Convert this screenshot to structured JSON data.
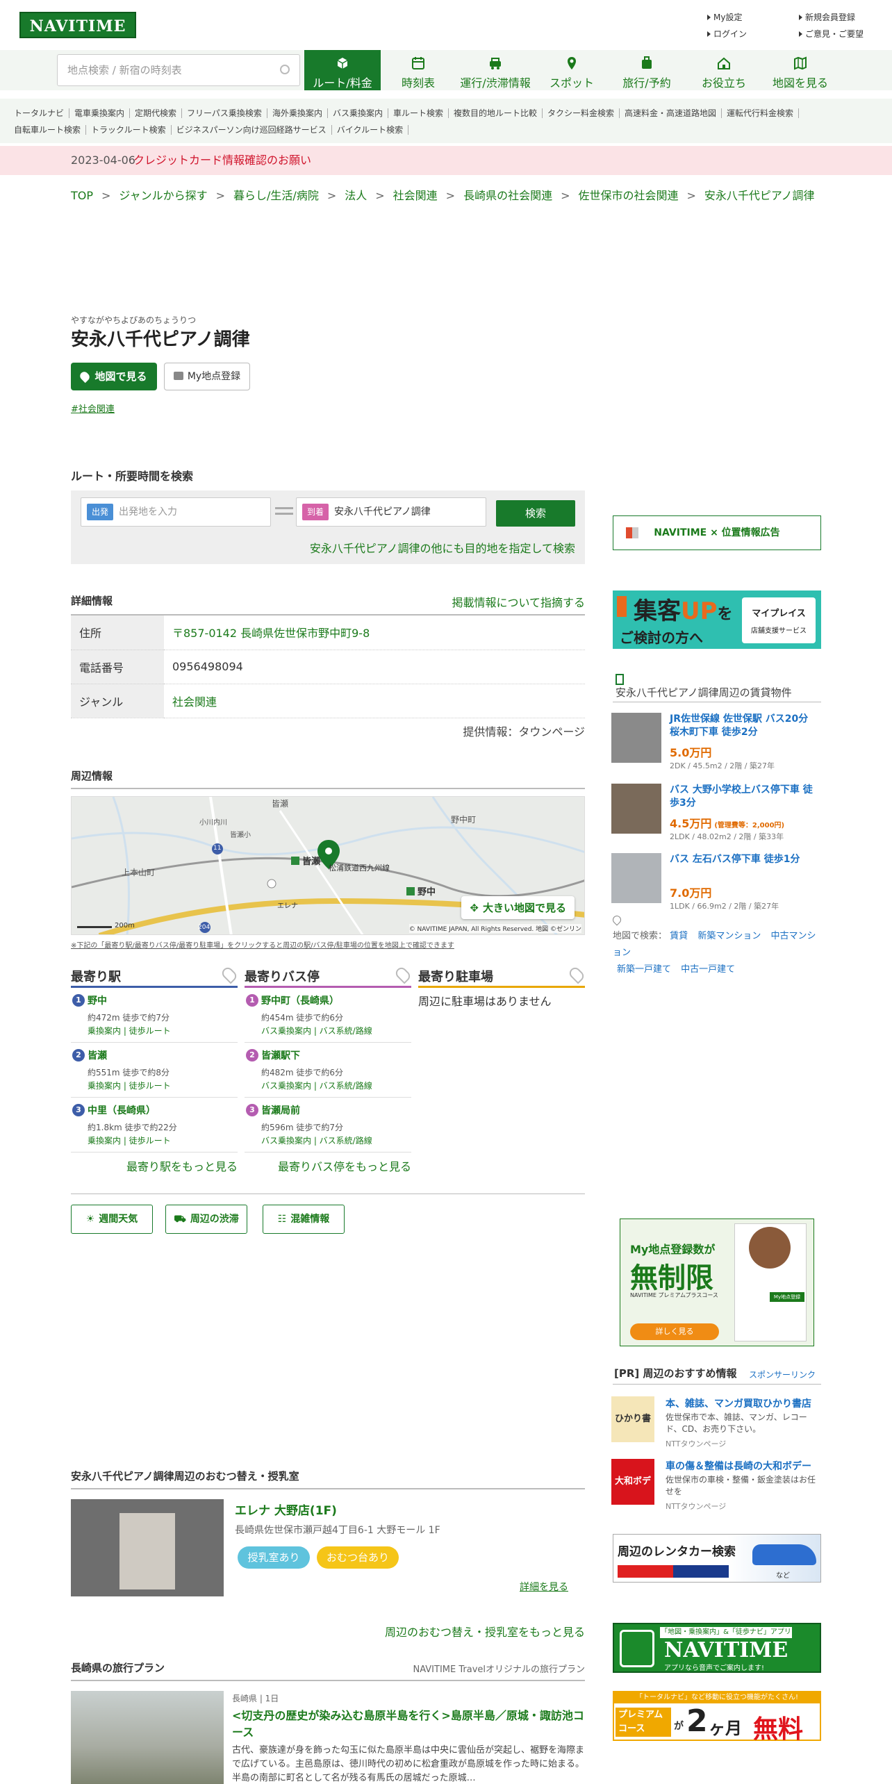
{
  "header": {
    "logo": "NAVITIME",
    "links": [
      "My設定",
      "新規会員登録",
      "ログイン",
      "ご意見・ご要望"
    ]
  },
  "search": {
    "placeholder": "地点検索 / 新宿の時刻表"
  },
  "nav": [
    "ルート/料金",
    "時刻表",
    "運行/渋滞情報",
    "スポット",
    "旅行/予約",
    "お役立ち",
    "地図を見る"
  ],
  "subnav": {
    "row1": [
      "トータルナビ",
      "電車乗換案内",
      "定期代検索",
      "フリーパス乗換検索",
      "海外乗換案内",
      "バス乗換案内",
      "車ルート検索",
      "複数目的地ルート比較",
      "タクシー料金検索",
      "高速料金・高速道路地図",
      "運転代行料金検索"
    ],
    "row2": [
      "自転車ルート検索",
      "トラックルート検索",
      "ビジネスパーソン向け巡回経路サービス",
      "バイクルート検索"
    ]
  },
  "notice": {
    "date": "2023-04-06",
    "text": "クレジットカード情報確認のお願い"
  },
  "breadcrumb": [
    "TOP",
    "ジャンルから探す",
    "暮らし/生活/病院",
    "法人",
    "社会関連",
    "長崎県の社会関連",
    "佐世保市の社会関連",
    "安永八千代ピアノ調律"
  ],
  "spot": {
    "kana": "やすながやちよぴあのちょうりつ",
    "name": "安永八千代ピアノ調律",
    "map_btn": "地図で見る",
    "my_btn": "My地点登録",
    "tag": "#社会関連"
  },
  "route": {
    "heading": "ルート・所要時間を検索",
    "from_badge": "出発",
    "from_placeholder": "出発地を入力",
    "to_badge": "到着",
    "to_value": "安永八千代ピアノ調律",
    "search": "検索",
    "multi": "安永八千代ピアノ調律の他にも目的地を指定して検索"
  },
  "detail": {
    "heading": "詳細情報",
    "report": "掲載情報について指摘する",
    "rows": [
      {
        "k": "住所",
        "v": "〒857-0142 長崎県佐世保市野中町9-8"
      },
      {
        "k": "電話番号",
        "v": "0956498094"
      },
      {
        "k": "ジャンル",
        "v": "社会関連"
      }
    ],
    "source": "提供情報：タウンページ"
  },
  "nearby": {
    "heading": "周辺情報",
    "map_labels": [
      "皆瀬",
      "野中町",
      "上本山町",
      "皆瀬",
      "松浦鉄道西九州線",
      "野中",
      "エレナ",
      "11",
      "204",
      "小川内川",
      "皆瀬小"
    ],
    "bigmap": "大きい地図で見る",
    "scale": "200m",
    "copyright": "© NAVITIME JAPAN, All Rights Reserved. 地図 ©ゼンリン",
    "note": "※下記の「最寄り駅/最寄りバス停/最寄り駐車場」をクリックすると周辺の駅/バス停/駐車場の位置を地図上で確認できます"
  },
  "stations": {
    "heading": "最寄り駅",
    "items": [
      {
        "n": "1",
        "name": "野中",
        "dist": "約472m 徒歩で約7分",
        "links": "乗換案内 | 徒歩ルート"
      },
      {
        "n": "2",
        "name": "皆瀬",
        "dist": "約551m 徒歩で約8分",
        "links": "乗換案内 | 徒歩ルート"
      },
      {
        "n": "3",
        "name": "中里（長崎県）",
        "dist": "約1.8km 徒歩で約22分",
        "links": "乗換案内 | 徒歩ルート"
      }
    ],
    "more": "最寄り駅をもっと見る"
  },
  "busstops": {
    "heading": "最寄りバス停",
    "items": [
      {
        "n": "1",
        "name": "野中町（長崎県）",
        "dist": "約454m 徒歩で約6分",
        "links": "バス乗換案内 | バス系統/路線"
      },
      {
        "n": "2",
        "name": "皆瀬駅下",
        "dist": "約482m 徒歩で約6分",
        "links": "バス乗換案内 | バス系統/路線"
      },
      {
        "n": "3",
        "name": "皆瀬局前",
        "dist": "約596m 徒歩で約7分",
        "links": "バス乗換案内 | バス系統/路線"
      }
    ],
    "more": "最寄りバス停をもっと見る"
  },
  "parking": {
    "heading": "最寄り駐車場",
    "empty": "周辺に駐車場はありません"
  },
  "chips": [
    "週間天気",
    "周辺の渋滞",
    "混雑情報"
  ],
  "nursing": {
    "heading": "安永八千代ピアノ調律周辺のおむつ替え・授乳室",
    "name": "エレナ 大野店(1F)",
    "addr": "長崎県佐世保市瀬戸越4丁目6-1 大野モール 1F",
    "tag1": "授乳室あり",
    "tag2": "おむつ台あり",
    "detail": "詳細を見る",
    "more": "周辺のおむつ替え・授乳室をもっと見る"
  },
  "travel": {
    "heading": "長崎県の旅行プラン",
    "sub": "NAVITIME Travelオリジナルの旅行プラン",
    "meta": "長崎県 | 1日",
    "title": "<切支丹の歴史が染み込む島原半島を行く>島原半島／原城・諏訪池コース",
    "desc": "古代、豪族達が身を飾った勾玉に似た島原半島は中央に雲仙岳が突起し、裾野を海際まで広げている。主邑島原は、徳川時代の初めに松倉重政が島原城を作った時に始まる。半島の南部に町名として名が残る有馬氏の居城だった原城…"
  },
  "right": {
    "ad_btn": "NAVITIME × 位置情報広告",
    "banner1": {
      "a": "集客",
      "b": "UP",
      "c": "を",
      "d": "ご検討の方へ",
      "e": "マイプレイス",
      "f": "店舗支援サービス"
    },
    "rent_heading": "安永八千代ピアノ調律周辺の賃貸物件",
    "rent": [
      {
        "t": "JR佐世保線 佐世保駅 バス20分 桜木町下車 徒歩2分",
        "p": "5.0万円",
        "pn": "",
        "s": "2DK / 45.5m2 / 2階 / 築27年"
      },
      {
        "t": "バス 大野小学校上バス停下車 徒歩3分",
        "p": "4.5万円",
        "pn": "(管理費等：2,000円)",
        "s": "2LDK / 48.02m2 / 2階 / 築33年"
      },
      {
        "t": "バス 左石バス停下車 徒歩1分",
        "p": "7.0万円",
        "pn": "",
        "s": "1LDK / 66.9m2 / 2階 / 築27年"
      }
    ],
    "rent_links_label": "地図で検索：",
    "rent_links": [
      "賃貸",
      "新築マンション",
      "中古マンション",
      "新築一戸建て",
      "中古一戸建て"
    ],
    "promo": {
      "a": "My地点登録数が",
      "b": "無制限",
      "c": "NAVITIME プレミアムプラスコース",
      "d": "詳しく見る",
      "e": "My地点登録"
    },
    "pr_heading": "[PR] 周辺のおすすめ情報",
    "pr_sub": "スポンサーリンク",
    "pr": [
      {
        "logo": "ひかり書店",
        "t": "本、雑誌、マンガ買取ひかり書店",
        "d": "佐世保市で本、雑誌、マンガ、レコード、CD、お売り下さい。",
        "n": "NTTタウンページ"
      },
      {
        "logo": "大和ボデー",
        "t": "車の傷＆整備は長崎の大和ボデー",
        "d": "佐世保市の車検・整備・鈑金塗装はお任せを",
        "n": "NTTタウンページ"
      }
    ],
    "rental": "周辺のレンタカー検索",
    "rental_sub": "など",
    "app": {
      "a": "「地図・乗換案内」&「徒歩ナビ」アプリ",
      "b": "NAVITIME",
      "c": "アプリなら音声でご案内します!"
    },
    "premium": {
      "a": "「トータルナビ」など移動に役立つ機能がたくさん!",
      "b": "プレミアム",
      "c": "コース",
      "d": "が",
      "e": "2",
      "f": "ヶ月",
      "g": "無料"
    }
  }
}
